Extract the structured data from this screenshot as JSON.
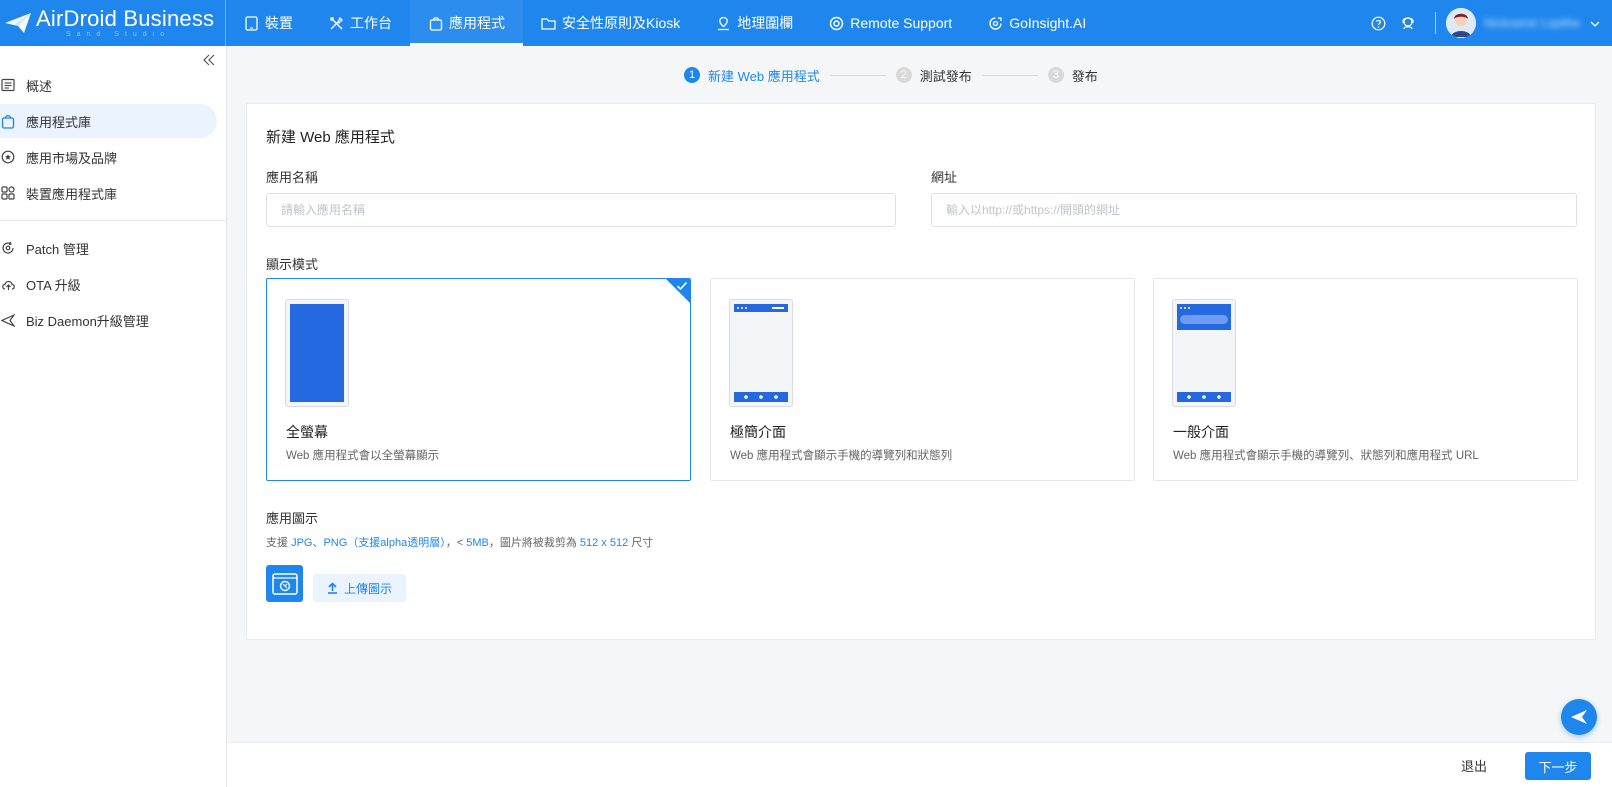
{
  "brand": {
    "name": "AirDroid Business",
    "sub": "Sand Studio"
  },
  "nav": {
    "items": [
      {
        "label": "裝置",
        "icon": "tablet-icon"
      },
      {
        "label": "工作台",
        "icon": "tools-icon"
      },
      {
        "label": "應用程式",
        "icon": "app-bag-icon",
        "active": true
      },
      {
        "label": "安全性原則及Kiosk",
        "icon": "folder-icon"
      },
      {
        "label": "地理圍欄",
        "icon": "geofence-icon"
      },
      {
        "label": "Remote Support",
        "icon": "lifebuoy-icon"
      },
      {
        "label": "GoInsight.AI",
        "icon": "ai-icon"
      }
    ]
  },
  "user": {
    "name": "Nickname Lopithe"
  },
  "sidebar": {
    "items": [
      {
        "label": "概述",
        "icon": "overview-icon"
      },
      {
        "label": "應用程式庫",
        "icon": "app-library-icon",
        "active": true
      },
      {
        "label": "應用市場及品牌",
        "icon": "market-icon"
      },
      {
        "label": "裝置應用程式庫",
        "icon": "device-apps-icon"
      }
    ],
    "items2": [
      {
        "label": "Patch 管理",
        "icon": "patch-icon"
      },
      {
        "label": "OTA 升級",
        "icon": "cloud-upload-icon"
      },
      {
        "label": "Biz Daemon升級管理",
        "icon": "send-icon"
      }
    ]
  },
  "steps": [
    {
      "num": "1",
      "label": "新建 Web 應用程式",
      "active": true
    },
    {
      "num": "2",
      "label": "測試發布"
    },
    {
      "num": "3",
      "label": "發布"
    }
  ],
  "form": {
    "title": "新建 Web 應用程式",
    "name_label": "應用名稱",
    "name_placeholder": "請輸入應用名稱",
    "url_label": "網址",
    "url_placeholder": "輸入以http://或https://開頭的網址",
    "display_label": "顯示模式",
    "modes": [
      {
        "name": "全螢幕",
        "desc": "Web 應用程式會以全螢幕顯示",
        "selected": true
      },
      {
        "name": "極簡介面",
        "desc": "Web 應用程式會顯示手機的導覽列和狀態列"
      },
      {
        "name": "一般介面",
        "desc": "Web 應用程式會顯示手機的導覽列、狀態列和應用程式 URL"
      }
    ],
    "icon_label": "應用圖示",
    "icon_hint": {
      "prefix": "支援 ",
      "formats": "JPG、PNG（支援alpha透明層）",
      "sep1": "，< ",
      "size": "5MB",
      "sep2": "，圖片將被裁剪為 ",
      "dims": "512 x 512",
      "suffix": " 尺寸"
    },
    "upload_label": "上傳圖示"
  },
  "footer": {
    "exit_label": "退出",
    "next_label": "下一步"
  },
  "colors": {
    "primary": "#1f86ee",
    "active_bg": "#eaf3fe"
  }
}
